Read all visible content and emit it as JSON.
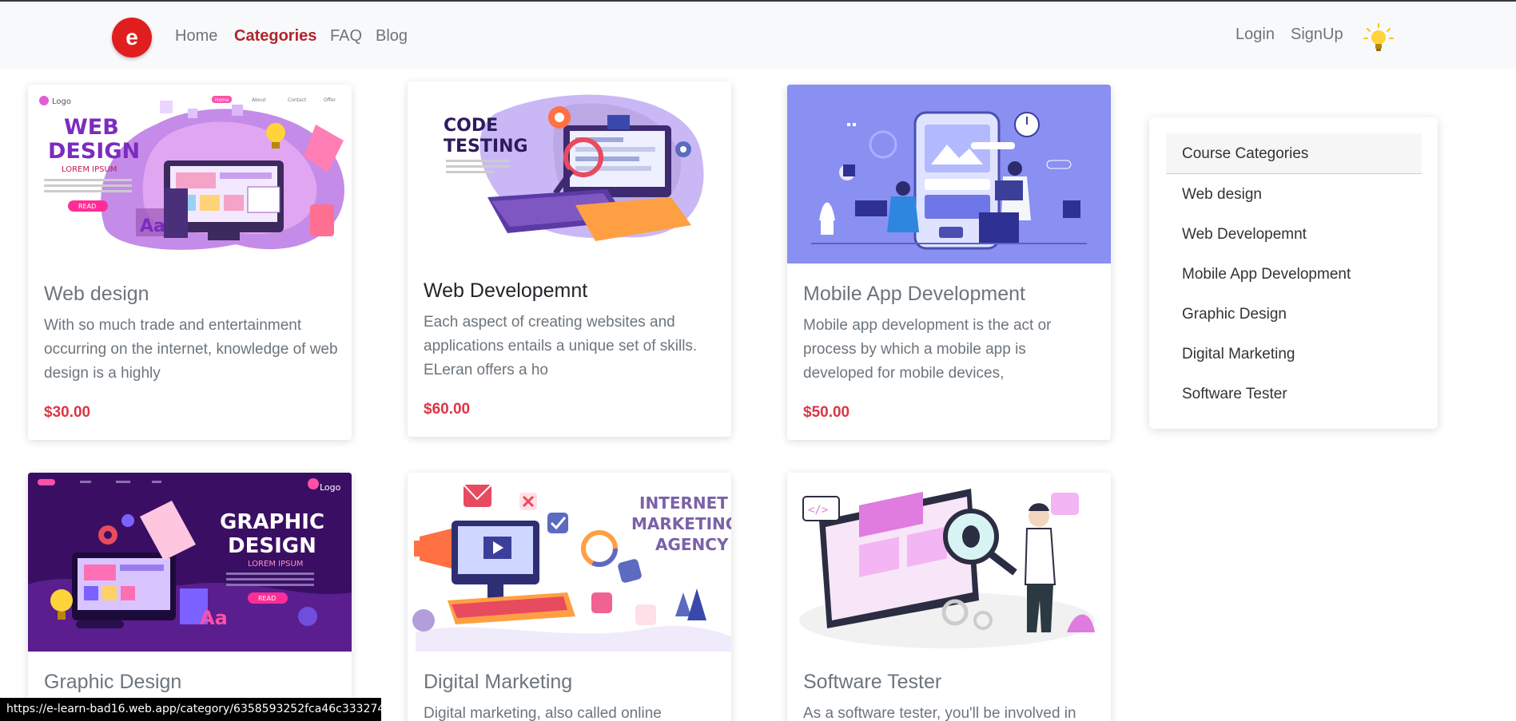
{
  "nav": {
    "logo_letter": "e",
    "links": [
      "Home",
      "Categories",
      "FAQ",
      "Blog"
    ],
    "active": "Categories",
    "login": "Login",
    "signup": "SignUp"
  },
  "cards": [
    {
      "title": "Web design",
      "text": "With so much trade and entertainment occurring on the internet, knowledge of web design is a highly",
      "price": "$30.00",
      "image": {
        "heading_line1": "WEB",
        "heading_line2": "DESIGN",
        "sub": "LOREM IPSUM",
        "button": "READ",
        "logo": "Logo",
        "menu": [
          "Home",
          "About",
          "Contact",
          "Offer"
        ]
      }
    },
    {
      "title": "Web Developemnt",
      "text": "Each aspect of creating websites and applications entails a unique set of skills. ELeran offers a ho",
      "price": "$60.00",
      "image": {
        "heading_line1": "CODE",
        "heading_line2": "TESTING"
      }
    },
    {
      "title": "Mobile App Development",
      "text": "Mobile app development is the act or process by which a mobile app is developed for mobile devices,",
      "price": "$50.00",
      "image": {}
    },
    {
      "title": "Graphic Design",
      "text": "",
      "price": "",
      "image": {
        "heading_line1": "GRAPHIC",
        "heading_line2": "DESIGN",
        "sub": "LOREM IPSUM",
        "button": "READ",
        "logo": "Logo"
      }
    },
    {
      "title": "Digital Marketing",
      "text": "Digital marketing, also called online",
      "price": "",
      "image": {
        "heading_line1": "INTERNET",
        "heading_line2": "MARKETING",
        "heading_line3": "AGENCY"
      }
    },
    {
      "title": "Software Tester",
      "text": "As a software tester, you'll be involved in",
      "price": "",
      "image": {}
    }
  ],
  "sidebar": {
    "header": "Course Categories",
    "items": [
      "Web design",
      "Web Developemnt",
      "Mobile App Development",
      "Graphic Design",
      "Digital Marketing",
      "Software Tester"
    ]
  },
  "status_url": "https://e-learn-bad16.web.app/category/6358593252fca46c333274d8",
  "colors": {
    "accent": "#b0252e",
    "price": "#dc3545",
    "logo": "#e01e1e",
    "mobile_bg": "#8a8ff2",
    "graphic_bg": "#3a0f63"
  }
}
